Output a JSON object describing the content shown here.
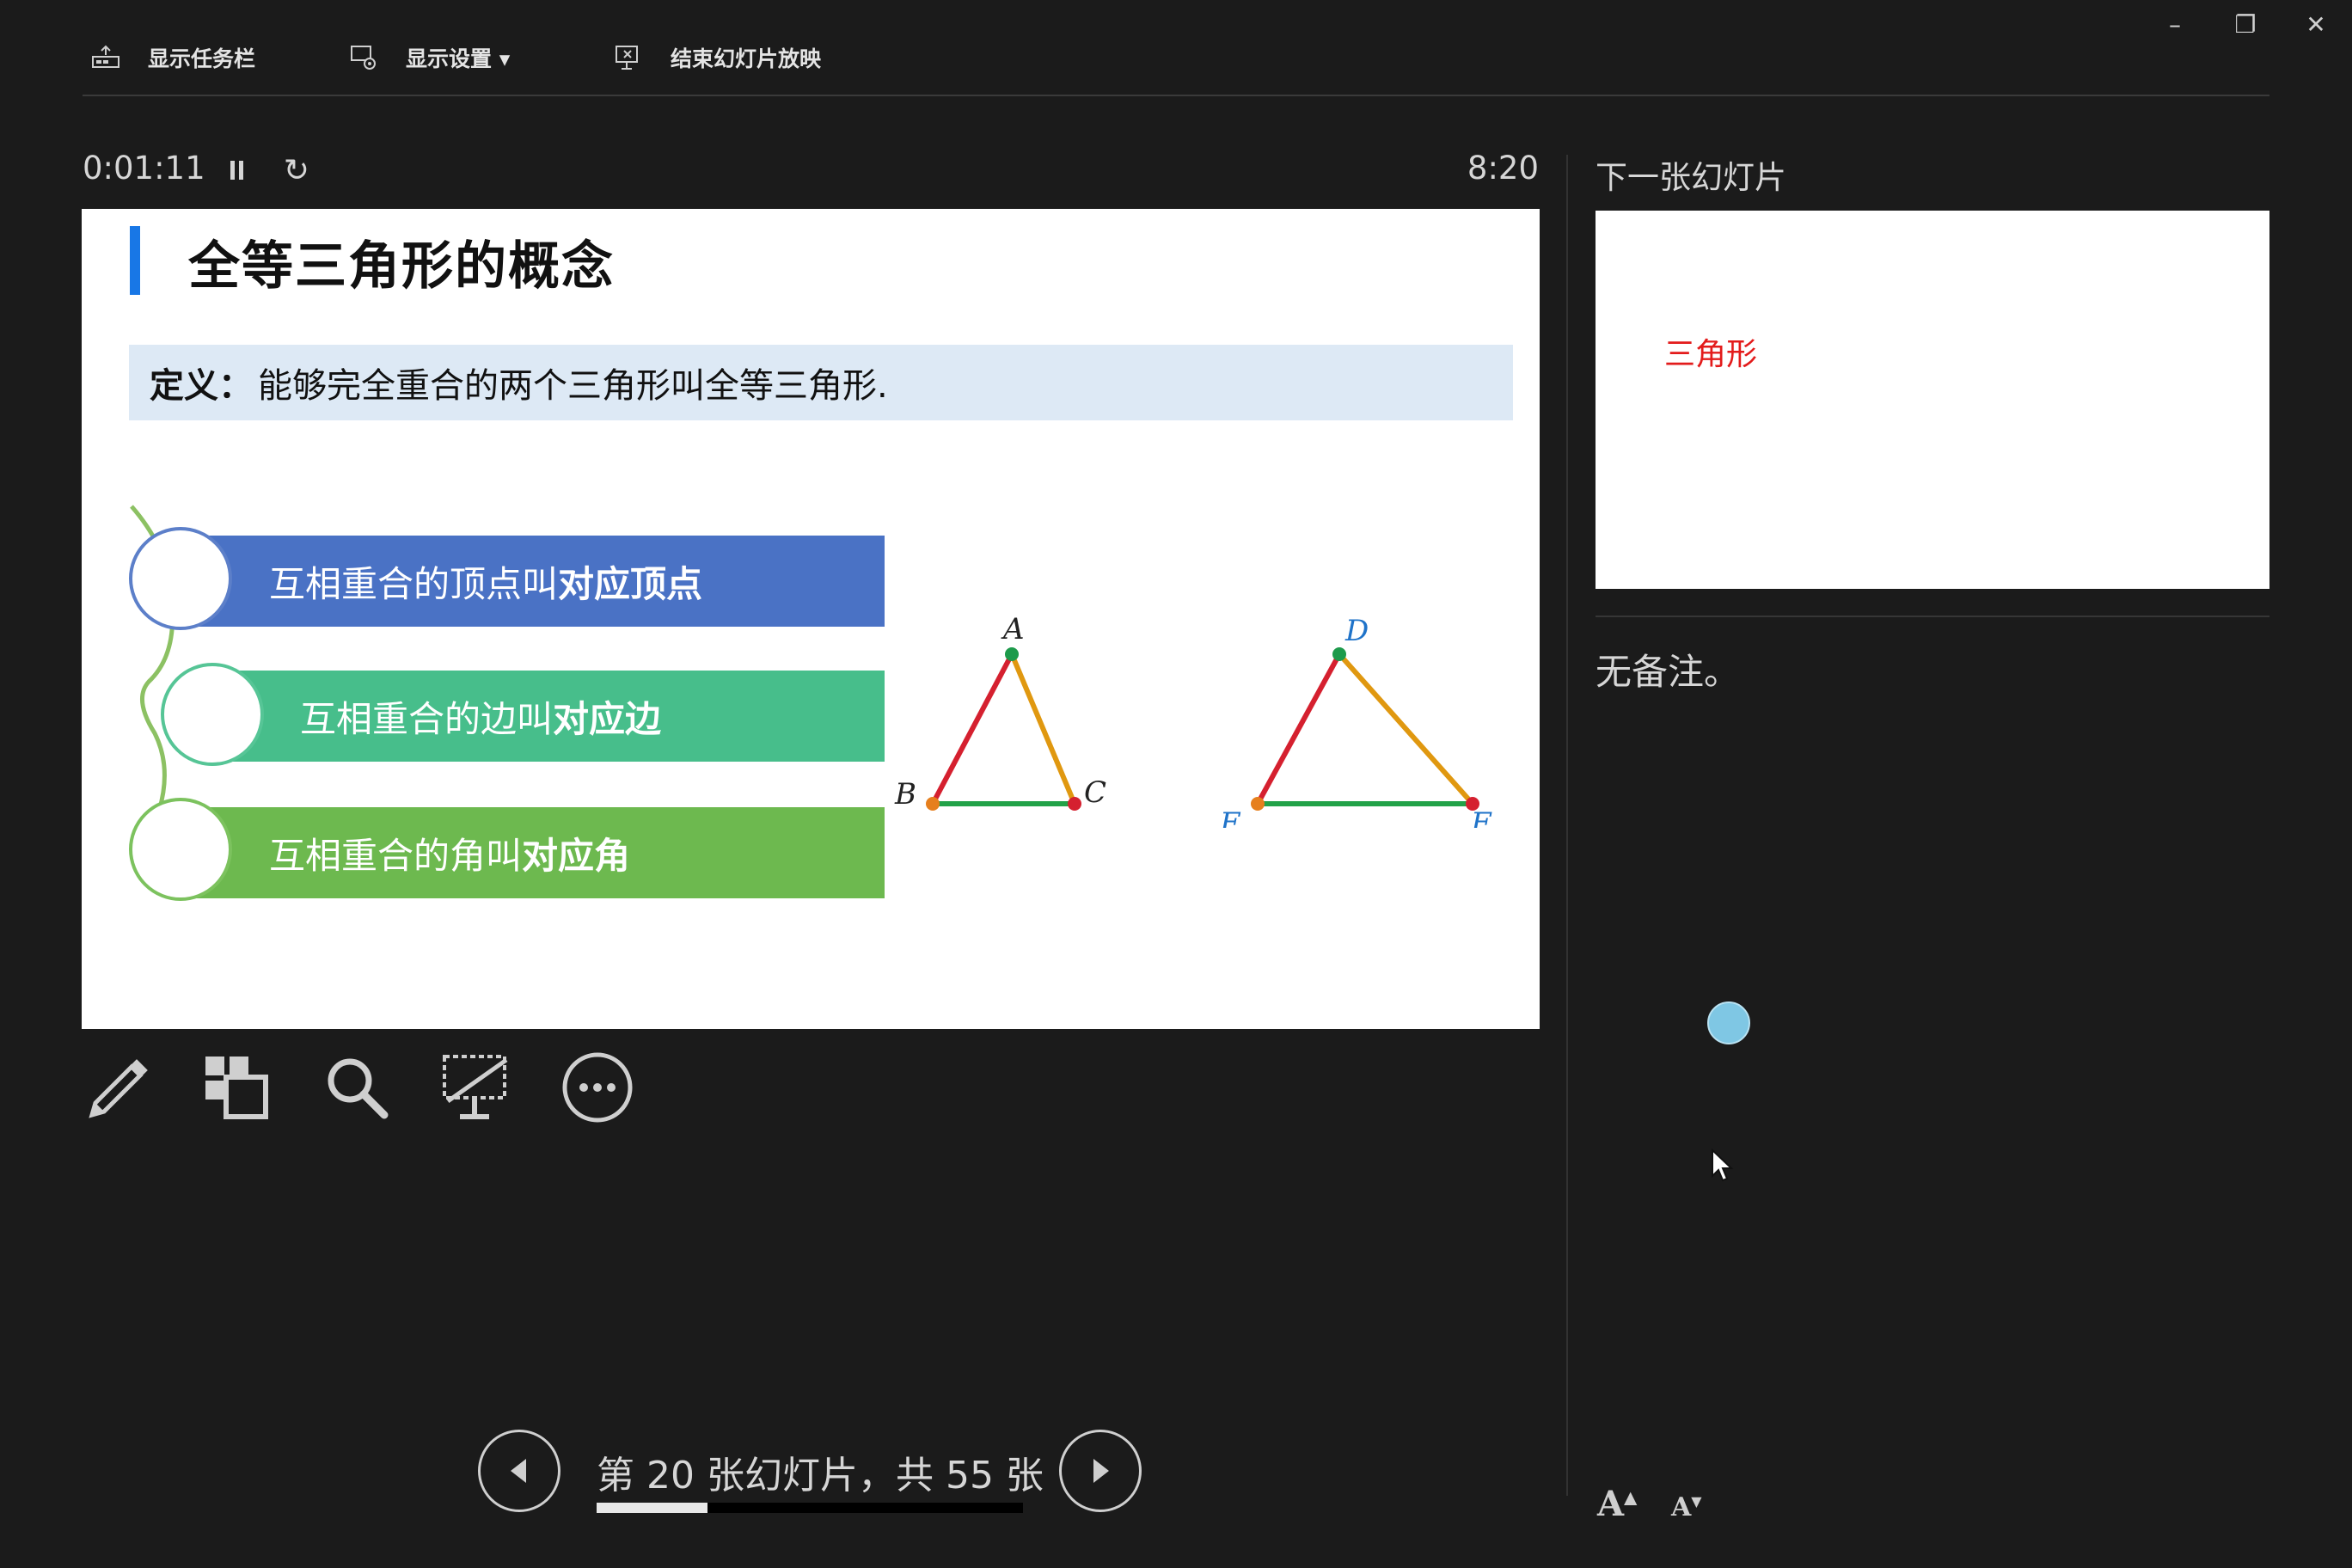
{
  "window": {
    "minimize_label": "–",
    "restore_label": "❐",
    "close_label": "✕"
  },
  "toolbar": {
    "show_taskbar": "显示任务栏",
    "display_settings": "显示设置 ▾",
    "end_slideshow": "结束幻灯片放映"
  },
  "timer": {
    "elapsed": "0:01:11",
    "clock": "8:20",
    "restart_label": "↻"
  },
  "current_slide": {
    "title": "全等三角形的概念",
    "definition_label": "定义：",
    "definition_text": "能够完全重合的两个三角形叫全等三角形.",
    "bands": [
      {
        "prefix": "互相重合的顶点叫",
        "bold": "对应顶点",
        "color": "#4a72c5"
      },
      {
        "prefix": "互相重合的边叫",
        "bold": "对应边",
        "color": "#47be8b"
      },
      {
        "prefix": "互相重合的角叫",
        "bold": "对应角",
        "color": "#6db94f"
      }
    ],
    "triangle1": {
      "a": "A",
      "b": "B",
      "c": "C"
    },
    "triangle2": {
      "a": "D",
      "b": "E",
      "c": "F"
    }
  },
  "next_slide": {
    "label": "下一张幻灯片",
    "preview_text": "三角形"
  },
  "notes": {
    "text": "无备注。"
  },
  "tools": [
    "pen-tool",
    "see-all-slides",
    "zoom",
    "black-screen",
    "more-options"
  ],
  "navigation": {
    "counter_text": "第 20 张幻灯片，共 55 张",
    "current": 20,
    "total": 55,
    "progress_fraction": 0.26
  },
  "font_buttons": {
    "increase": "A",
    "decrease": "A"
  },
  "colors": {
    "background": "#1b1b1b",
    "accent_blue": "#1877e6",
    "next_text_red": "#e31b1b"
  }
}
